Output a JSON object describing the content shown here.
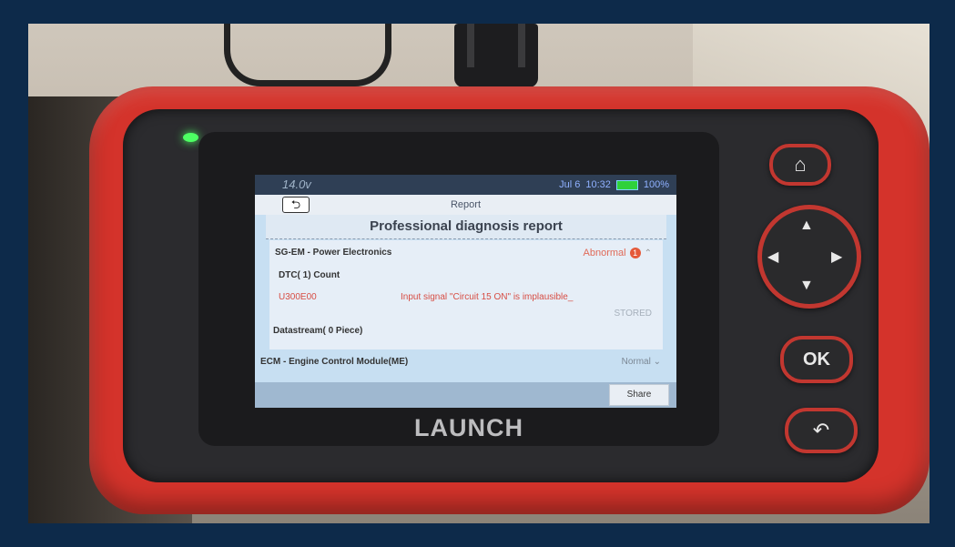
{
  "device": {
    "brand": "LAUNCH"
  },
  "status_bar": {
    "voltage": "14.0v",
    "date": "Jul 6",
    "time": "10:32",
    "battery": "100%"
  },
  "header": {
    "title": "Report"
  },
  "report": {
    "heading": "Professional diagnosis report",
    "system1": {
      "name": "SG-EM - Power Electronics",
      "status": "Abnormal",
      "badge_count": "1",
      "dtc_count_label": "DTC( 1) Count",
      "dtc_code": "U300E00",
      "dtc_description": "Input signal \"Circuit 15 ON\" is implausible_",
      "dtc_state": "STORED",
      "datastream_label": "Datastream( 0 Piece)"
    },
    "system2": {
      "name": "ECM - Engine Control Module(ME)",
      "status": "Normal"
    }
  },
  "footer": {
    "share_label": "Share"
  },
  "buttons": {
    "home_icon": "home-icon",
    "ok_label": "OK",
    "back_icon": "return-icon"
  },
  "colors": {
    "device_body": "#d4332b",
    "screen_bg": "#c7dff2",
    "error_text": "#d74d44",
    "led": "#4dff63"
  }
}
